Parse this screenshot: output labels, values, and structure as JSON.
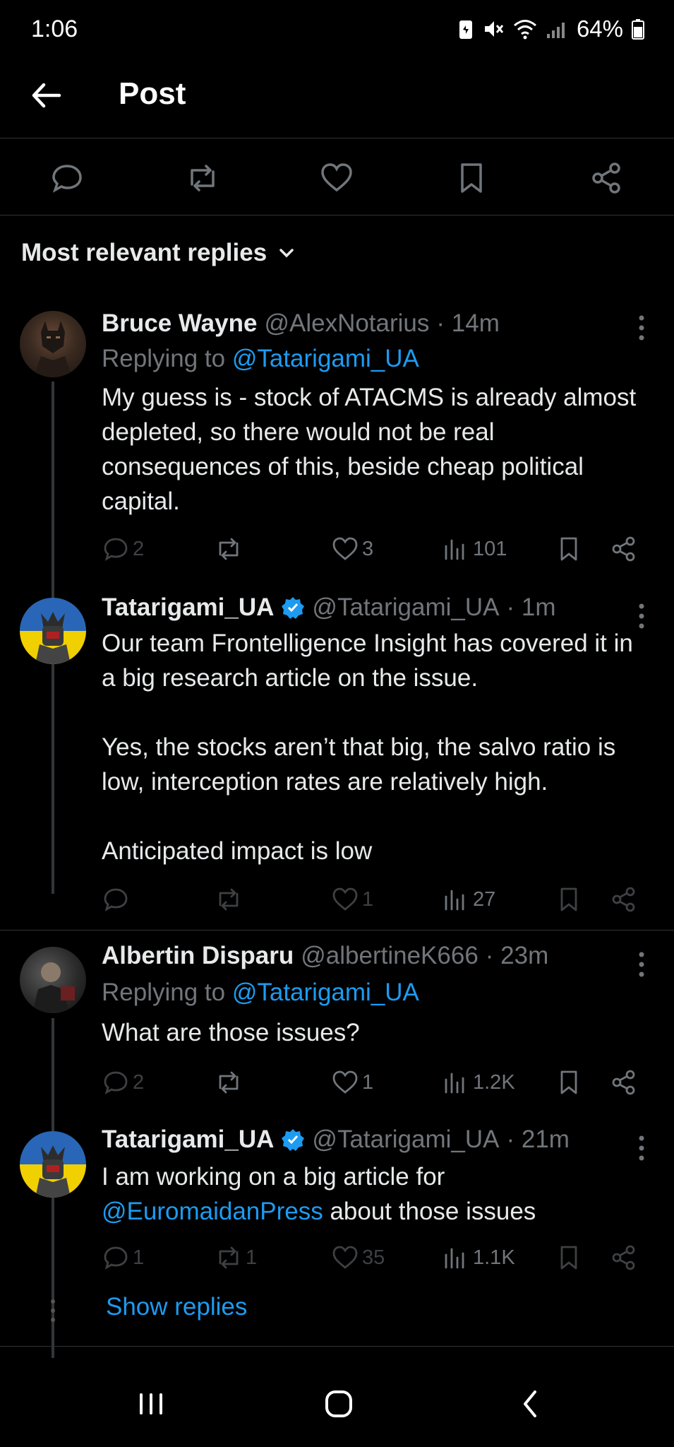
{
  "status_bar": {
    "time": "1:06",
    "battery": "64%"
  },
  "header": {
    "title": "Post"
  },
  "sort": {
    "label": "Most relevant replies"
  },
  "replies": [
    {
      "name": "Bruce Wayne",
      "handle": "@AlexNotarius",
      "time": "· 14m",
      "verified": false,
      "replying_prefix": "Replying to ",
      "replying_to": "@Tatarigami_UA",
      "text": "My guess is - stock of ATACMS is already almost depleted, so there would not be real consequences of this, beside cheap political capital.",
      "stats": {
        "replies": "2",
        "reposts": "",
        "likes": "3",
        "views": "101"
      }
    },
    {
      "name": "Tatarigami_UA",
      "handle": "@Tatarigami_UA",
      "time": "· 1m",
      "verified": true,
      "text_p1": "Our team Frontelligence Insight has covered it in a big research article on the issue.",
      "text_p2": "Yes, the stocks aren’t that big, the salvo ratio is low, interception rates are relatively high.",
      "text_p3": "Anticipated impact is low",
      "stats": {
        "replies": "",
        "reposts": "",
        "likes": "1",
        "views": "27"
      }
    },
    {
      "name": "Albertin Disparu",
      "handle": "@albertineK666",
      "time": "· 23m",
      "verified": false,
      "replying_prefix": "Replying to ",
      "replying_to": "@Tatarigami_UA",
      "text": "What are those issues?",
      "stats": {
        "replies": "2",
        "reposts": "",
        "likes": "1",
        "views": "1.2K"
      }
    },
    {
      "name": "Tatarigami_UA",
      "handle": "@Tatarigami_UA",
      "time": "· 21m",
      "verified": true,
      "text_line1": "I am working on a big article for",
      "text_mention": "@EuromaidanPress",
      "text_rest": " about those issues",
      "stats": {
        "replies": "1",
        "reposts": "1",
        "likes": "35",
        "views": "1.1K"
      }
    }
  ],
  "show_replies": "Show replies",
  "colors": {
    "background": "#000000",
    "accent": "#1d9bf0",
    "muted": "#71767b",
    "text": "#e7e9ea"
  }
}
